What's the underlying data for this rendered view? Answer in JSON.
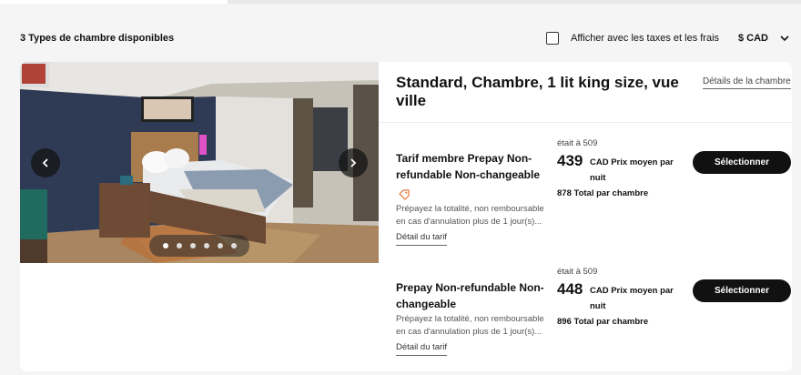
{
  "header": {
    "room_types_count": "3 Types de chambre disponibles",
    "tax_toggle_label": "Afficher avec les taxes et les frais",
    "tax_toggle_checked": false,
    "currency_label": "$ CAD"
  },
  "room": {
    "title": "Standard, Chambre, 1 lit king size, vue ville",
    "details_link": "Détails de la chambre",
    "gallery": {
      "image_count": 6,
      "active_index": 0
    }
  },
  "rates": [
    {
      "name": "Tarif membre Prepay Non-refundable Non-changeable",
      "has_member_tag_icon": true,
      "description": "Prépayez la totalité, non remboursable en cas d'annulation plus de 1 jour(s)...",
      "detail_link": "Détail du tarif",
      "was_price": "était à 509",
      "price": "439",
      "price_note": "CAD Prix moyen par nuit",
      "total": "878 Total par chambre",
      "select_label": "Sélectionner"
    },
    {
      "name": "Prepay Non-refundable Non-changeable",
      "has_member_tag_icon": false,
      "description": "Prépayez la totalité, non remboursable en cas d'annulation plus de 1 jour(s)...",
      "detail_link": "Détail du tarif",
      "was_price": "était à 509",
      "price": "448",
      "price_note": "CAD Prix moyen par nuit",
      "total": "896 Total par chambre",
      "select_label": "Sélectionner"
    }
  ],
  "colors": {
    "primary_button": "#111111",
    "tag_icon": "#e8743b",
    "page_background": "#f5f5f5"
  },
  "icons": [
    "checkbox-icon",
    "chevron-down-icon",
    "chevron-left-icon",
    "chevron-right-icon",
    "tag-icon"
  ]
}
